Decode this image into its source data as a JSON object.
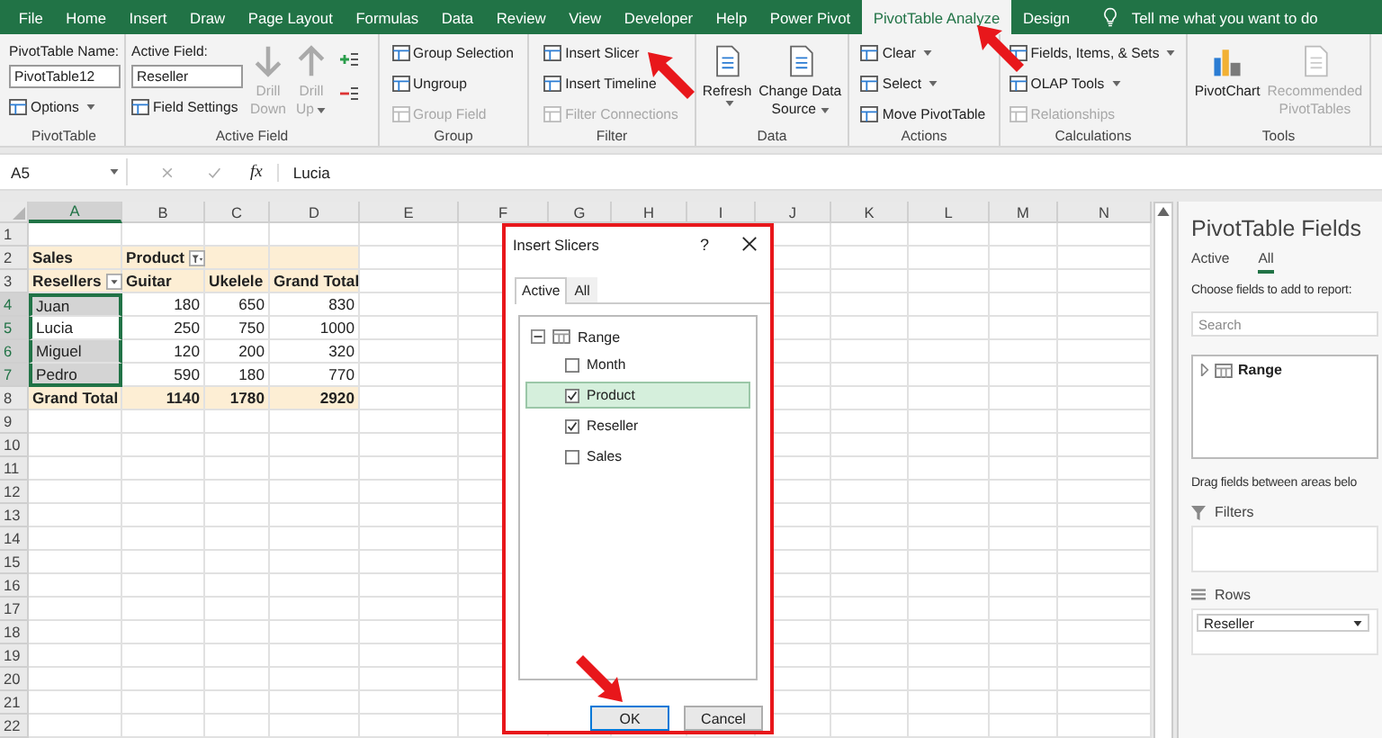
{
  "menu_tabs": [
    {
      "label": "File",
      "selected": false
    },
    {
      "label": "Home",
      "selected": false
    },
    {
      "label": "Insert",
      "selected": false
    },
    {
      "label": "Draw",
      "selected": false
    },
    {
      "label": "Page Layout",
      "selected": false
    },
    {
      "label": "Formulas",
      "selected": false
    },
    {
      "label": "Data",
      "selected": false
    },
    {
      "label": "Review",
      "selected": false
    },
    {
      "label": "View",
      "selected": false
    },
    {
      "label": "Developer",
      "selected": false
    },
    {
      "label": "Help",
      "selected": false
    },
    {
      "label": "Power Pivot",
      "selected": false
    },
    {
      "label": "PivotTable Analyze",
      "selected": true
    },
    {
      "label": "Design",
      "selected": false
    }
  ],
  "tell_me": "Tell me what you want to do",
  "ribbon_groups": [
    {
      "label": "PivotTable",
      "columns": [
        [
          {
            "kind": "label",
            "text": "PivotTable Name:"
          },
          {
            "kind": "field",
            "value": "PivotTable12"
          },
          {
            "kind": "small",
            "text": "Options",
            "disabled": false,
            "dropdown": true
          }
        ]
      ]
    },
    {
      "label": "Active Field",
      "columns": [
        [
          {
            "kind": "label",
            "text": "Active Field:"
          },
          {
            "kind": "field",
            "value": "Reseller"
          },
          {
            "kind": "small",
            "text": "Field Settings",
            "disabled": false,
            "dropdown": false
          }
        ],
        [
          {
            "kind": "large",
            "lines": [
              "Drill",
              "Down"
            ],
            "disabled": true,
            "dropdown": false
          }
        ],
        [
          {
            "kind": "large",
            "lines": [
              "Drill",
              "Up"
            ],
            "disabled": true,
            "dropdown": true
          }
        ],
        [
          {
            "kind": "expand"
          },
          {
            "kind": "collapse"
          }
        ]
      ]
    },
    {
      "label": "Group",
      "columns": [
        [
          {
            "kind": "small",
            "text": "Group Selection",
            "disabled": false,
            "dropdown": false
          },
          {
            "kind": "small",
            "text": "Ungroup",
            "disabled": false,
            "dropdown": false
          },
          {
            "kind": "small",
            "text": "Group Field",
            "disabled": true,
            "dropdown": false
          }
        ]
      ]
    },
    {
      "label": "Filter",
      "columns": [
        [
          {
            "kind": "small",
            "text": "Insert Slicer",
            "disabled": false,
            "dropdown": false
          },
          {
            "kind": "small",
            "text": "Insert Timeline",
            "disabled": false,
            "dropdown": false
          },
          {
            "kind": "small",
            "text": "Filter Connections",
            "disabled": true,
            "dropdown": false
          }
        ]
      ]
    },
    {
      "label": "Data",
      "columns": [
        [
          {
            "kind": "large",
            "lines": [
              "Refresh"
            ],
            "disabled": false,
            "dropdown": true
          }
        ],
        [
          {
            "kind": "large",
            "lines": [
              "Change Data",
              "Source"
            ],
            "disabled": false,
            "dropdown": true
          }
        ]
      ]
    },
    {
      "label": "Actions",
      "columns": [
        [
          {
            "kind": "small",
            "text": "Clear",
            "disabled": false,
            "dropdown": true
          },
          {
            "kind": "small",
            "text": "Select",
            "disabled": false,
            "dropdown": true
          },
          {
            "kind": "small",
            "text": "Move PivotTable",
            "disabled": false,
            "dropdown": false
          }
        ]
      ]
    },
    {
      "label": "Calculations",
      "columns": [
        [
          {
            "kind": "small",
            "text": "Fields, Items, & Sets",
            "disabled": false,
            "dropdown": true
          },
          {
            "kind": "small",
            "text": "OLAP Tools",
            "disabled": false,
            "dropdown": true
          },
          {
            "kind": "small",
            "text": "Relationships",
            "disabled": true,
            "dropdown": false
          }
        ]
      ]
    },
    {
      "label": "Tools",
      "columns": [
        [
          {
            "kind": "large",
            "lines": [
              "PivotChart"
            ],
            "disabled": false,
            "dropdown": false
          }
        ],
        [
          {
            "kind": "large",
            "lines": [
              "Recommended",
              "PivotTables"
            ],
            "disabled": true,
            "dropdown": false
          }
        ]
      ]
    }
  ],
  "formula_bar": {
    "name_box": "A5",
    "fx": "fx",
    "value": "Lucia"
  },
  "sheet": {
    "columns": [
      {
        "label": "A",
        "selected": true
      },
      {
        "label": "B",
        "selected": false
      },
      {
        "label": "C",
        "selected": false
      },
      {
        "label": "D",
        "selected": false
      },
      {
        "label": "E",
        "selected": false
      },
      {
        "label": "F",
        "selected": false
      },
      {
        "label": "G",
        "selected": false
      },
      {
        "label": "H",
        "selected": false
      },
      {
        "label": "I",
        "selected": false
      },
      {
        "label": "J",
        "selected": false
      },
      {
        "label": "K",
        "selected": false
      },
      {
        "label": "L",
        "selected": false
      },
      {
        "label": "M",
        "selected": false
      },
      {
        "label": "N",
        "selected": false
      }
    ],
    "rows": [
      {
        "label": "1",
        "selected": false
      },
      {
        "label": "2",
        "selected": false
      },
      {
        "label": "3",
        "selected": false
      },
      {
        "label": "4",
        "selected": true
      },
      {
        "label": "5",
        "selected": true
      },
      {
        "label": "6",
        "selected": true
      },
      {
        "label": "7",
        "selected": true
      },
      {
        "label": "8",
        "selected": false
      },
      {
        "label": "9",
        "selected": false
      },
      {
        "label": "10",
        "selected": false
      },
      {
        "label": "11",
        "selected": false
      },
      {
        "label": "12",
        "selected": false
      },
      {
        "label": "13",
        "selected": false
      },
      {
        "label": "14",
        "selected": false
      },
      {
        "label": "15",
        "selected": false
      },
      {
        "label": "16",
        "selected": false
      },
      {
        "label": "17",
        "selected": false
      },
      {
        "label": "18",
        "selected": false
      },
      {
        "label": "19",
        "selected": false
      },
      {
        "label": "20",
        "selected": false
      },
      {
        "label": "21",
        "selected": false
      },
      {
        "label": "22",
        "selected": false
      }
    ]
  },
  "pivot": {
    "values_field": "Sales",
    "column_field": {
      "label": "Product",
      "filtered": true
    },
    "row_field": "Resellers",
    "column_items": [
      "Guitar",
      "Ukelele"
    ],
    "total_label": "Grand Total",
    "rows": [
      {
        "label": "Juan",
        "values": [
          "180",
          "650",
          "830"
        ],
        "selected": true,
        "active": false
      },
      {
        "label": "Lucia",
        "values": [
          "250",
          "750",
          "1000"
        ],
        "selected": true,
        "active": true
      },
      {
        "label": "Miguel",
        "values": [
          "120",
          "200",
          "320"
        ],
        "selected": true,
        "active": false
      },
      {
        "label": "Pedro",
        "values": [
          "590",
          "180",
          "770"
        ],
        "selected": true,
        "active": false
      }
    ],
    "grand_total": {
      "label": "Grand Total",
      "values": [
        "1140",
        "1780",
        "2920"
      ]
    }
  },
  "dialog": {
    "title": "Insert Slicers",
    "help": "?",
    "tabs": [
      {
        "label": "Active",
        "selected": true
      },
      {
        "label": "All",
        "selected": false
      }
    ],
    "tree": [
      {
        "label": "Range",
        "expanded": true,
        "children": [
          {
            "label": "Month",
            "checked": false,
            "selected": false
          },
          {
            "label": "Product",
            "checked": true,
            "selected": true
          },
          {
            "label": "Reseller",
            "checked": true,
            "selected": false
          },
          {
            "label": "Sales",
            "checked": false,
            "selected": false
          }
        ]
      }
    ],
    "buttons": [
      {
        "label": "OK",
        "default": true
      },
      {
        "label": "Cancel",
        "default": false
      }
    ]
  },
  "pane": {
    "title": "PivotTable Fields",
    "tabs": [
      {
        "label": "Active",
        "selected": false
      },
      {
        "label": "All",
        "selected": true
      }
    ],
    "instruction": "Choose fields to add to report:",
    "search": {
      "placeholder": "Search"
    },
    "fields": [
      {
        "label": "Range",
        "expanded": false
      }
    ],
    "drag_hint": "Drag fields between areas belo",
    "areas": [
      {
        "label": "Filters",
        "kind": "filters"
      },
      {
        "label": "Rows",
        "kind": "rows",
        "items": [
          {
            "label": "Reseller"
          }
        ]
      }
    ]
  }
}
